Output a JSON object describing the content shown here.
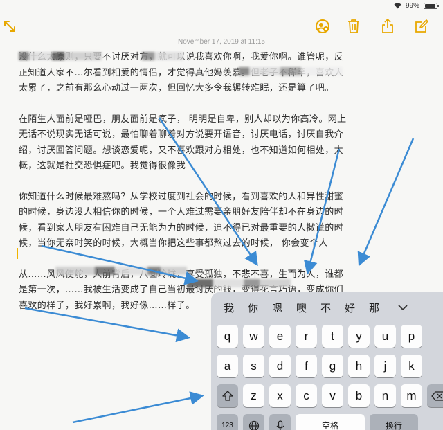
{
  "status": {
    "battery_text": "99%"
  },
  "note": {
    "date": "November 17, 2019 at 11:15",
    "paragraphs": [
      "没什么太原则，只要不讨厌对方，就可以说我喜欢你啊，我爱你啊。谁管呢，反正知道人家不…尔看到相爱的情侣，才觉得真他妈羡慕。但老子不稀罕，喜欢人太累了，之前有那么心动过一两次，但回忆大多令我辗转难眠，还是算了吧。",
      "在陌生人面前是哑巴，朋友面前是疯子， 明明是自卑，别人却以为你高冷。网上无话不说现实无话可说，最怕聊着聊着对方说要开语音，讨厌电话，讨厌自我介绍，讨厌回答问题。想谈恋爱呢，又不喜欢跟对方相处，也不知道如何相处，大概，这就是社交恐惧症吧。我觉得很像我",
      "你知道什么时候最难熬吗？从学校过度到社会的时候，看到喜欢的人和异性甜蜜的时候，身边没人相信你的时候，一个人难过需要亲朋好友陪伴却不在身边的时候，看到家人朋友有困难自己无能为力的时候，迫不得已对最重要的人撒谎的时候，当你无奈时笑的时候，大概当你把这些事都熬过去的时候， 你会变个人",
      "从……风风使舵，人前背后，八面玲珑，享受孤独，不悲不喜，生而为人，谁都是第一次，……我被生活变成了自己当初最讨厌的钱，变得花言巧语，变成你们喜欢的样子，我好累啊，我好像……样子。"
    ]
  },
  "keyboard": {
    "candidates": [
      "我",
      "你",
      "嗯",
      "噢",
      "不",
      "好",
      "那"
    ],
    "row1": [
      "q",
      "w",
      "e",
      "r",
      "t",
      "y",
      "u",
      "p"
    ],
    "row2": [
      "a",
      "s",
      "d",
      "f",
      "g",
      "h",
      "j",
      "k"
    ],
    "row3": [
      "z",
      "x",
      "c",
      "v",
      "b",
      "n",
      "m"
    ],
    "row4": {
      "numbers": "123",
      "space": "空格",
      "return": "换行"
    }
  },
  "colors": {
    "accent": "#e8a800",
    "arrow": "#3b8bd4"
  }
}
